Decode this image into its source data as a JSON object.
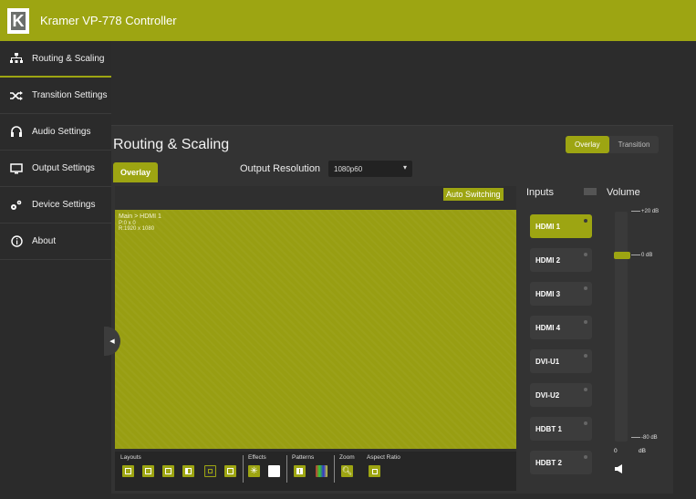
{
  "app": {
    "title": "Kramer VP-778 Controller",
    "logo_letter": "K"
  },
  "sidebar": {
    "items": [
      {
        "label": "Routing & Scaling",
        "icon": "sitemap-icon"
      },
      {
        "label": "Transition Settings",
        "icon": "shuffle-icon"
      },
      {
        "label": "Audio Settings",
        "icon": "headphones-icon"
      },
      {
        "label": "Output Settings",
        "icon": "monitor-icon"
      },
      {
        "label": "Device Settings",
        "icon": "gears-icon"
      },
      {
        "label": "About",
        "icon": "info-icon"
      }
    ]
  },
  "main": {
    "title": "Routing & Scaling",
    "mode_toggle": {
      "options": [
        "Overlay",
        "Transition"
      ],
      "selected": "Overlay"
    },
    "tab": "Overlay",
    "output_resolution": {
      "label": "Output Resolution",
      "value": "1080p60"
    },
    "auto_switching": "Auto Switching",
    "preview": {
      "line1": "Main > HDMI 1",
      "line2": "P:0 x 0",
      "line3": "R:1920 x 1080"
    },
    "toolbar": {
      "layouts_label": "Layouts",
      "effects_label": "Effects",
      "patterns_label": "Patterns",
      "zoom_label": "Zoom",
      "aspect_label": "Aspect Ratio"
    }
  },
  "inputs": {
    "title": "Inputs",
    "items": [
      "HDMI 1",
      "HDMI 2",
      "HDMI 3",
      "HDMI 4",
      "DVI-U1",
      "DVI-U2",
      "HDBT 1",
      "HDBT 2"
    ],
    "selected": "HDMI 1"
  },
  "volume": {
    "title": "Volume",
    "max_label": "+20 dB",
    "mid_label": "0 dB",
    "min_label": "-80 dB",
    "value": "0",
    "unit": "dB"
  },
  "colors": {
    "accent": "#9da512",
    "background": "#2f2f2f"
  }
}
